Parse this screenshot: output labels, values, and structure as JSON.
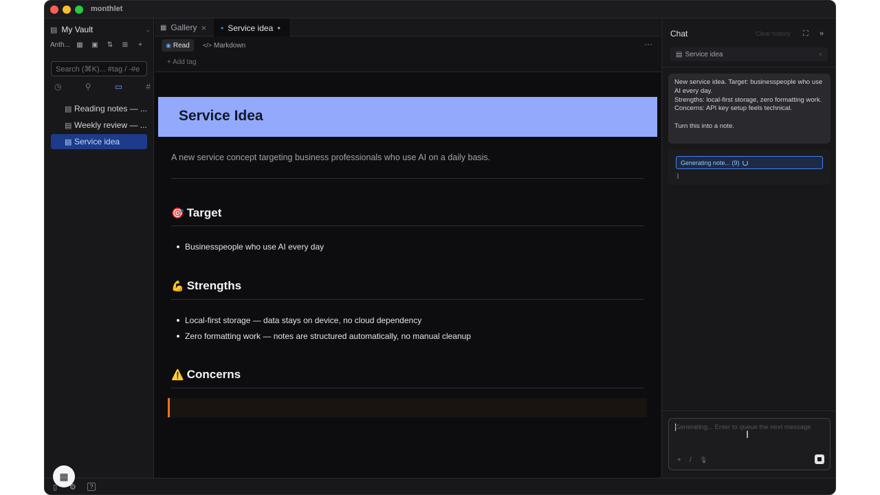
{
  "app": {
    "title": "monthlet",
    "colors": {
      "accent": "#3b82f6",
      "banner": "#93a9fb",
      "callout_border": "#f97316"
    }
  },
  "sidebar": {
    "vault_icon": "book-icon",
    "vault_name": "My Vault",
    "vault_chevron": "⌄",
    "workspace_label": "Anth...",
    "toolbar_icons": [
      "grid-icon",
      "calendar-icon",
      "sort-icon",
      "new-folder-icon",
      "add-icon"
    ],
    "toolbar_glyphs": [
      "▦",
      "▣",
      "⇅",
      "⊞",
      "+"
    ],
    "search_placeholder": "Search (⌘K)... #tag / -#e",
    "filters": {
      "recent": "◷",
      "pinned": "⚲",
      "folders": "▭",
      "tags": "#"
    },
    "files": [
      {
        "label": "Reading notes — ...",
        "icon": "▤"
      },
      {
        "label": "Weekly review — ...",
        "icon": "▤"
      },
      {
        "label": "Service idea",
        "icon": "▤"
      }
    ]
  },
  "tabs": [
    {
      "label": "Gallery",
      "icon": "▦",
      "close": "×"
    },
    {
      "label": "Service idea",
      "dot": "•",
      "status": "●"
    }
  ],
  "modes": {
    "read": "Read",
    "read_icon": "◉",
    "markdown": "Markdown",
    "markdown_icon": "</>",
    "more": "···"
  },
  "add_tag": "+ Add tag",
  "document": {
    "title": "Service Idea",
    "lead": "A new service concept targeting business professionals who use AI on a daily basis.",
    "sections": [
      {
        "emoji": "🎯",
        "heading": "Target",
        "bullets": [
          "Businesspeople who use AI every day"
        ]
      },
      {
        "emoji": "💪",
        "heading": "Strengths",
        "bullets": [
          "Local-first storage — data stays on device, no cloud dependency",
          "Zero formatting work — notes are structured automatically, no manual cleanup"
        ]
      },
      {
        "emoji": "⚠️",
        "heading": "Concerns",
        "bullets": []
      }
    ]
  },
  "chat": {
    "title": "Chat",
    "clear_history": "Clear history",
    "expand_icon": "⛶",
    "collapse_icon": "»",
    "context_file": "Service idea",
    "context_icon": "▤",
    "context_close": "×",
    "user_message": [
      "New service idea. Target: businesspeople who use AI every day.",
      "Strengths: local-first storage, zero formatting work.",
      "Concerns: API key setup feels technical.",
      "",
      "Turn this into a note."
    ],
    "generating": "Generating note... (9)",
    "input_placeholder": "Generating... Enter to queue the next message",
    "input_icons": [
      "+",
      "/",
      "🎙"
    ]
  },
  "statusbar": {
    "panel_icon": "▯",
    "settings_icon": "⚙",
    "help_icon": "?",
    "calendar_icon": "▦"
  }
}
